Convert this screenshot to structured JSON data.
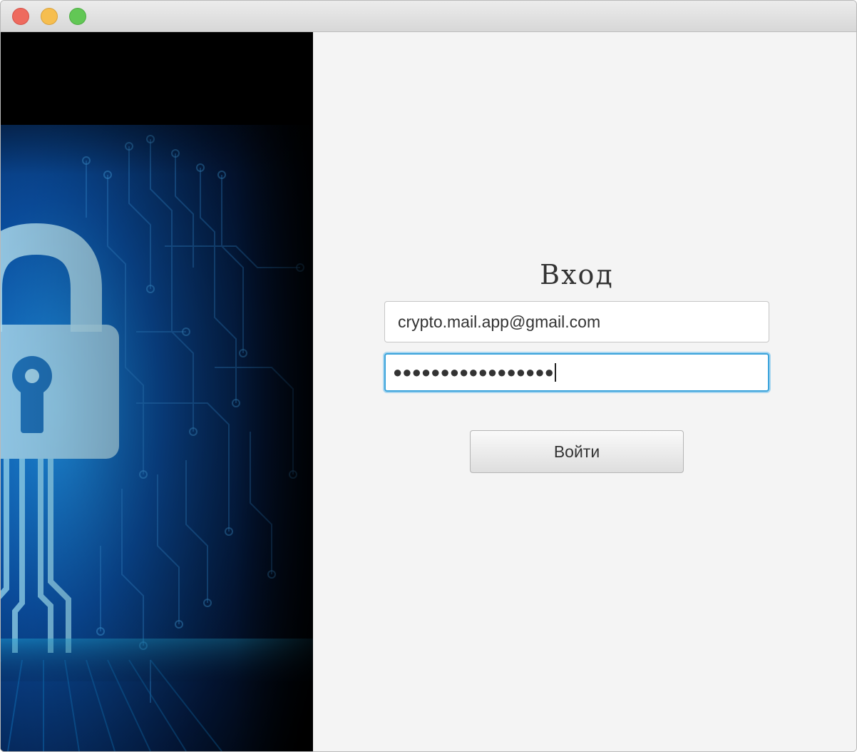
{
  "window": {
    "controls": {
      "close_icon": "close-icon",
      "minimize_icon": "minimize-icon",
      "zoom_icon": "zoom-icon",
      "close_color": "#ee6a5e",
      "minimize_color": "#f6be4f",
      "zoom_color": "#62c755"
    }
  },
  "illustration": {
    "icon": "padlock-circuit-icon",
    "accent_color": "#1e8fd8"
  },
  "login": {
    "title": "Вход",
    "email_value": "crypto.mail.app@gmail.com",
    "password_mask": "●●●●●●●●●●●●●●●●●",
    "submit_label": "Войти",
    "focus_color": "#3aa3db"
  }
}
